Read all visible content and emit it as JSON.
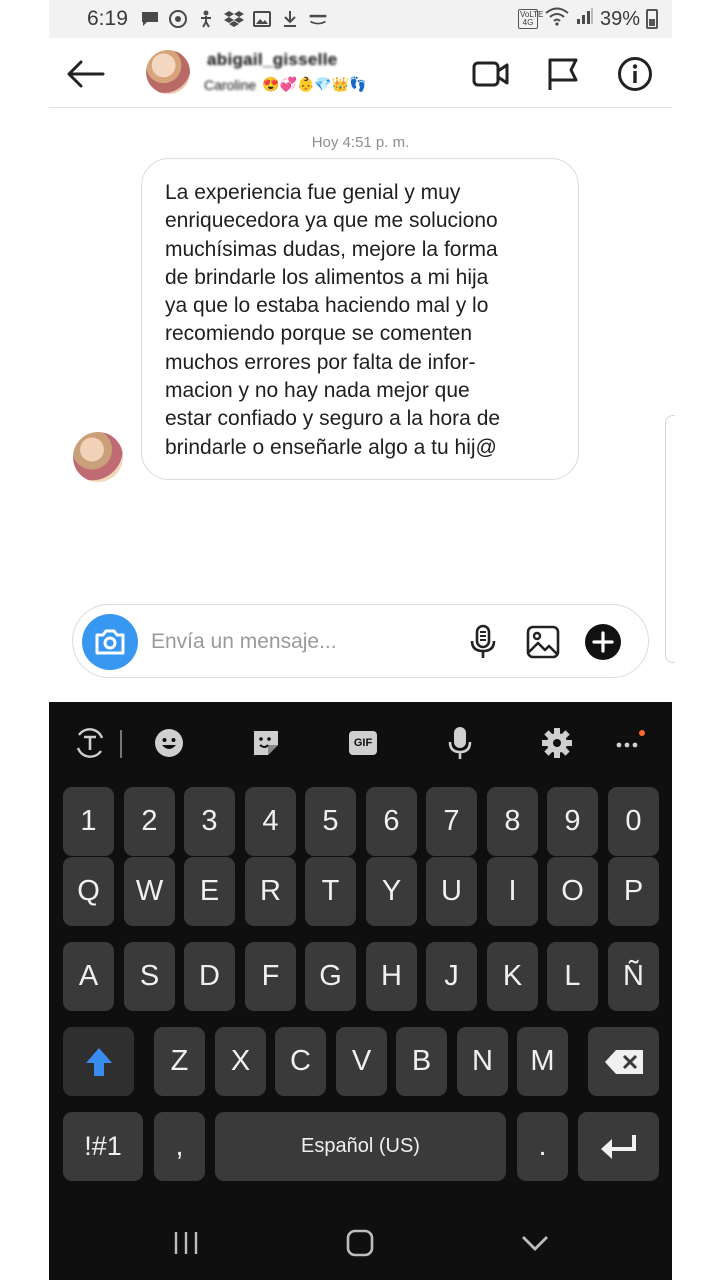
{
  "status_bar": {
    "time": "6:19",
    "volte": "VoLTE 4G",
    "battery": "39%",
    "icons": [
      "chat-icon",
      "chrome-icon",
      "accessibility-icon",
      "dropbox-icon",
      "gallery-icon",
      "download-icon",
      "amazon-icon"
    ]
  },
  "header": {
    "username": "abigail_gisselle",
    "subtitle": "Caroline",
    "subtitle_emojis": "😍💞👶💎👑👣"
  },
  "chat": {
    "timestamp": "Hoy 4:51 p. m.",
    "message_lines": [
      "La experiencia fue genial y muy",
      "enriquecedora ya que me soluciono",
      "muchísimas dudas, mejore la forma",
      "de brindarle los alimentos a mi hija",
      "ya que lo estaba haciendo mal y lo",
      "recomiendo porque se comenten",
      "muchos errores por falta de infor-",
      "macion y no hay nada mejor que",
      "estar confiado y seguro a la hora de",
      "brindarle o enseñarle algo a tu hij@"
    ]
  },
  "composer": {
    "placeholder": "Envía un mensaje..."
  },
  "keyboard": {
    "toolbar": {
      "gif": "GIF"
    },
    "row_numbers": [
      "1",
      "2",
      "3",
      "4",
      "5",
      "6",
      "7",
      "8",
      "9",
      "0"
    ],
    "row_top": [
      "Q",
      "W",
      "E",
      "R",
      "T",
      "Y",
      "U",
      "I",
      "O",
      "P"
    ],
    "row_mid": [
      "A",
      "S",
      "D",
      "F",
      "G",
      "H",
      "J",
      "K",
      "L",
      "Ñ"
    ],
    "row_bottom": [
      "Z",
      "X",
      "C",
      "V",
      "B",
      "N",
      "M"
    ],
    "symbols": "!#1",
    "comma": ",",
    "space": "Español (US)",
    "period": "."
  },
  "colors": {
    "accent_blue": "#3897f0",
    "keyboard_bg": "#0f0f0f",
    "key_bg": "#3a3a3a",
    "notification_dot": "#ff6a2a"
  }
}
